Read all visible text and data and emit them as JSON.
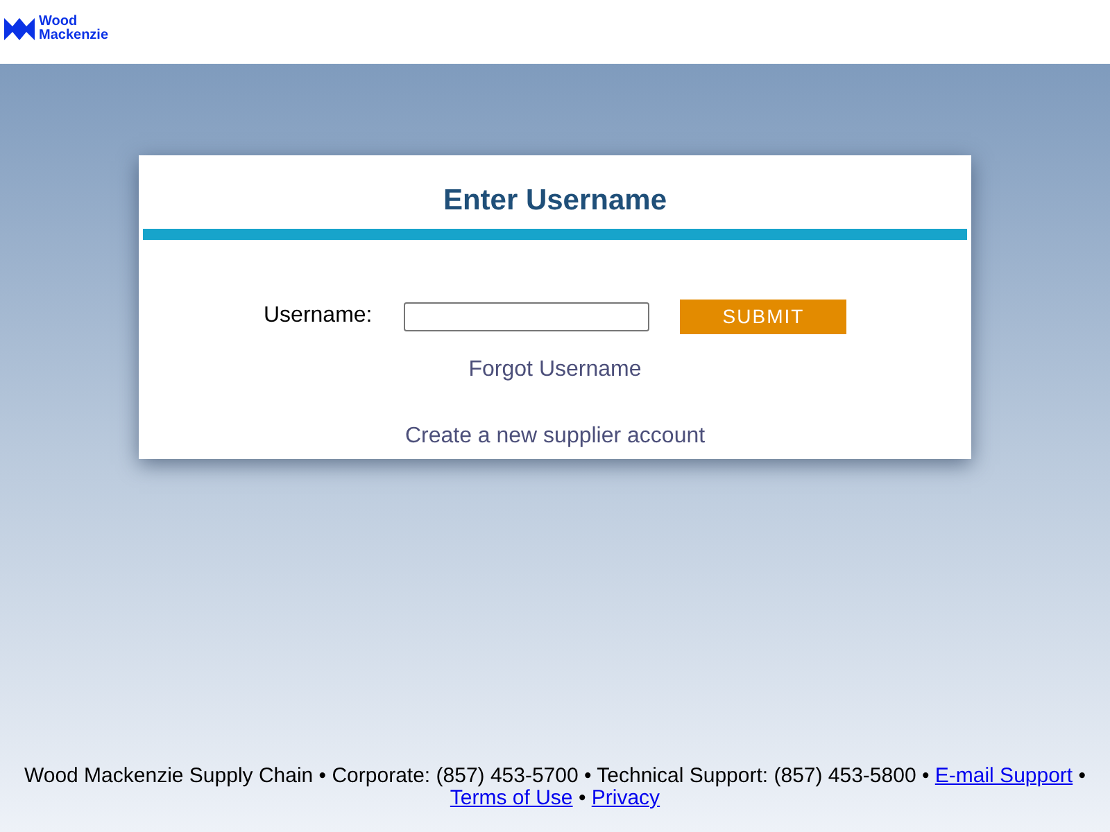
{
  "header": {
    "logo_lines": [
      "Wood",
      "Mackenzie"
    ]
  },
  "card": {
    "title": "Enter Username",
    "field_label": "Username:",
    "submit": "SUBMIT",
    "links": [
      "Forgot Username",
      "Create a new supplier account"
    ]
  },
  "footer": {
    "parts": [
      {
        "kind": "text",
        "text": "Wood Mackenzie Supply Chain • Corporate: (857) 453-5700 • Technical Support: (857) 453-5800 • "
      },
      {
        "kind": "link",
        "text": "E-mail Support"
      },
      {
        "kind": "text",
        "text": " • "
      },
      {
        "kind": "link",
        "text": "Terms of Use"
      },
      {
        "kind": "text",
        "text": " • "
      },
      {
        "kind": "link",
        "text": "Privacy"
      }
    ]
  }
}
